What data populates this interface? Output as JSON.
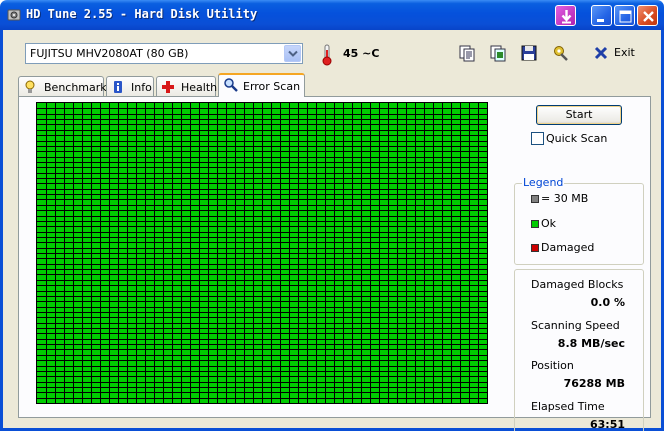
{
  "window": {
    "title": "HD Tune 2.55 - Hard Disk Utility"
  },
  "toolbar": {
    "drive": "FUJITSU MHV2080AT (80 GB)",
    "temperature": "45 ~C",
    "exit_label": "Exit",
    "icons": [
      "copy-text-icon",
      "copy-image-icon",
      "save-icon",
      "options-icon"
    ]
  },
  "tabs": [
    {
      "label": "Benchmark",
      "icon": "benchmark-icon",
      "active": false
    },
    {
      "label": "Info",
      "icon": "info-icon",
      "active": false
    },
    {
      "label": "Health",
      "icon": "health-icon",
      "active": false
    },
    {
      "label": "Error Scan",
      "icon": "error-scan-icon",
      "active": true
    }
  ],
  "scan": {
    "start_label": "Start",
    "quick_scan_label": "Quick Scan",
    "quick_scan_checked": false,
    "grid_columns": 50,
    "grid_rows": 56,
    "ok_color": "#00cc00",
    "damaged_color": "#cc0000"
  },
  "legend": {
    "title": "Legend",
    "items": [
      {
        "label": "= 30 MB",
        "color": "#808080"
      },
      {
        "label": "Ok",
        "color": "#00cc00"
      },
      {
        "label": "Damaged",
        "color": "#cc0000"
      }
    ]
  },
  "stats": {
    "damaged_blocks_label": "Damaged Blocks",
    "damaged_blocks_value": "0.0 %",
    "scanning_speed_label": "Scanning Speed",
    "scanning_speed_value": "8.8 MB/sec",
    "position_label": "Position",
    "position_value": "76288 MB",
    "elapsed_label": "Elapsed Time",
    "elapsed_value": "63:51"
  }
}
